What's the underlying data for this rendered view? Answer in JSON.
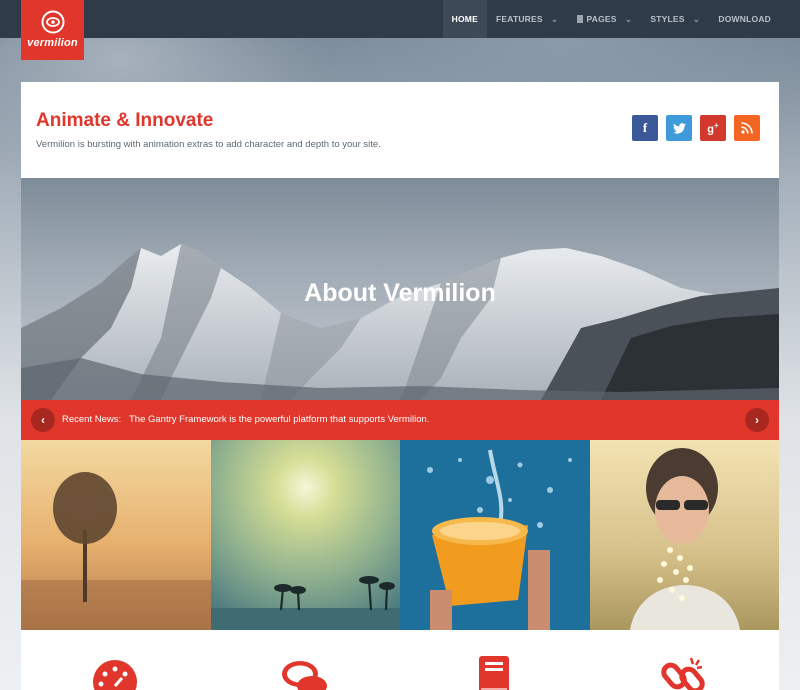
{
  "brand": {
    "name": "vermilion",
    "logo_icon": "vermilion-logo-icon",
    "accent": "#e0362b"
  },
  "nav": {
    "items": [
      {
        "label": "Home",
        "active": true
      },
      {
        "label": "Features",
        "dropdown": true
      },
      {
        "label": "Pages",
        "dropdown": true,
        "icon": "page-icon"
      },
      {
        "label": "Styles",
        "dropdown": true
      },
      {
        "label": "Download"
      }
    ]
  },
  "header": {
    "title": "Animate & Innovate",
    "subtitle": "Vermilion is bursting with animation extras to add character and depth to your site.",
    "social": [
      {
        "icon": "facebook-icon",
        "glyph": "f",
        "color": "#3b5998"
      },
      {
        "icon": "twitter-icon",
        "glyph": "t",
        "color": "#3e9ad8"
      },
      {
        "icon": "google-plus-icon",
        "glyph": "g+",
        "color": "#d2382c"
      },
      {
        "icon": "rss-icon",
        "glyph": "rss",
        "color": "#f26522"
      }
    ]
  },
  "hero": {
    "title_light": "About",
    "title_bold": "Vermilion"
  },
  "news": {
    "label": "Recent News:",
    "text": "The Gantry Framework is the powerful platform that supports Vermilion.",
    "prev_icon": "chevron-left-icon",
    "next_icon": "chevron-right-icon"
  },
  "gallery": [
    {
      "name": "tree-sunset-photo"
    },
    {
      "name": "palm-sun-photo"
    },
    {
      "name": "water-bucket-photo"
    },
    {
      "name": "woman-flowers-photo"
    }
  ],
  "features": [
    {
      "icon": "dashboard-icon"
    },
    {
      "icon": "chat-icon"
    },
    {
      "icon": "book-icon"
    },
    {
      "icon": "broken-link-icon"
    }
  ]
}
